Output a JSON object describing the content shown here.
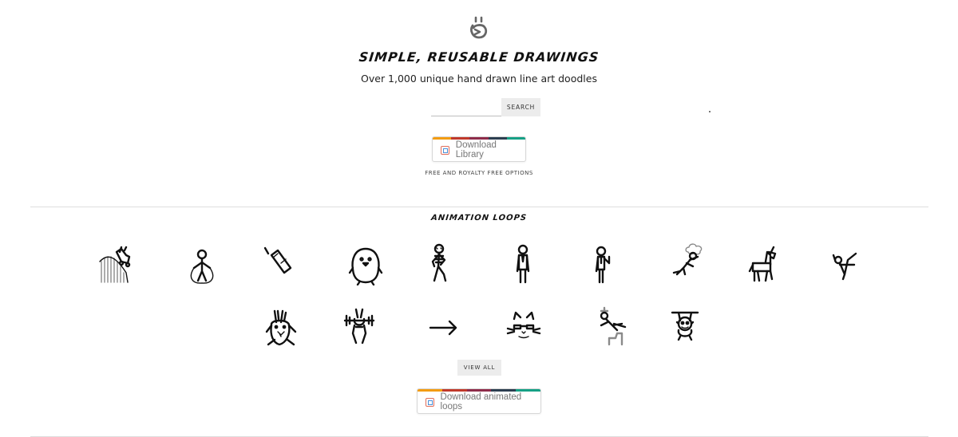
{
  "header": {
    "title": "SIMPLE, REUSABLE DRAWINGS",
    "subtitle": "Over 1,000 unique hand drawn line art doodles",
    "logo_icon": "doodle-face-logo-icon"
  },
  "search": {
    "value": "",
    "placeholder": "",
    "button_label": "SEARCH"
  },
  "download_library": {
    "label": "Download Library",
    "icon": "gumroad-icon"
  },
  "free_note": "FREE AND ROYALTY FREE OPTIONS",
  "loops_section": {
    "title": "ANIMATION LOOPS",
    "items": [
      {
        "icon": "roller-coaster-icon"
      },
      {
        "icon": "jump-rope-person-icon"
      },
      {
        "icon": "battery-icon"
      },
      {
        "icon": "penguin-icon"
      },
      {
        "icon": "dancing-skeleton-icon"
      },
      {
        "icon": "standing-man-icon"
      },
      {
        "icon": "waving-man-icon"
      },
      {
        "icon": "flying-person-icon"
      },
      {
        "icon": "unicorn-icon"
      },
      {
        "icon": "stretching-person-icon"
      },
      {
        "icon": "rabbit-icon"
      },
      {
        "icon": "weightlifting-bunny-icon"
      },
      {
        "icon": "arrow-icon"
      },
      {
        "icon": "cat-with-glasses-icon"
      },
      {
        "icon": "skydiving-person-icon"
      },
      {
        "icon": "hanging-monkey-icon"
      }
    ],
    "view_all_label": "VIEW ALL"
  },
  "download_loops": {
    "label": "Download animated loops",
    "icon": "gumroad-icon"
  },
  "colors": {
    "stripe": [
      "#f39c12",
      "#c0392b",
      "#8e2c4a",
      "#2c3e50",
      "#16a085"
    ],
    "button_bg": "#ececec",
    "divider": "#dedede"
  }
}
